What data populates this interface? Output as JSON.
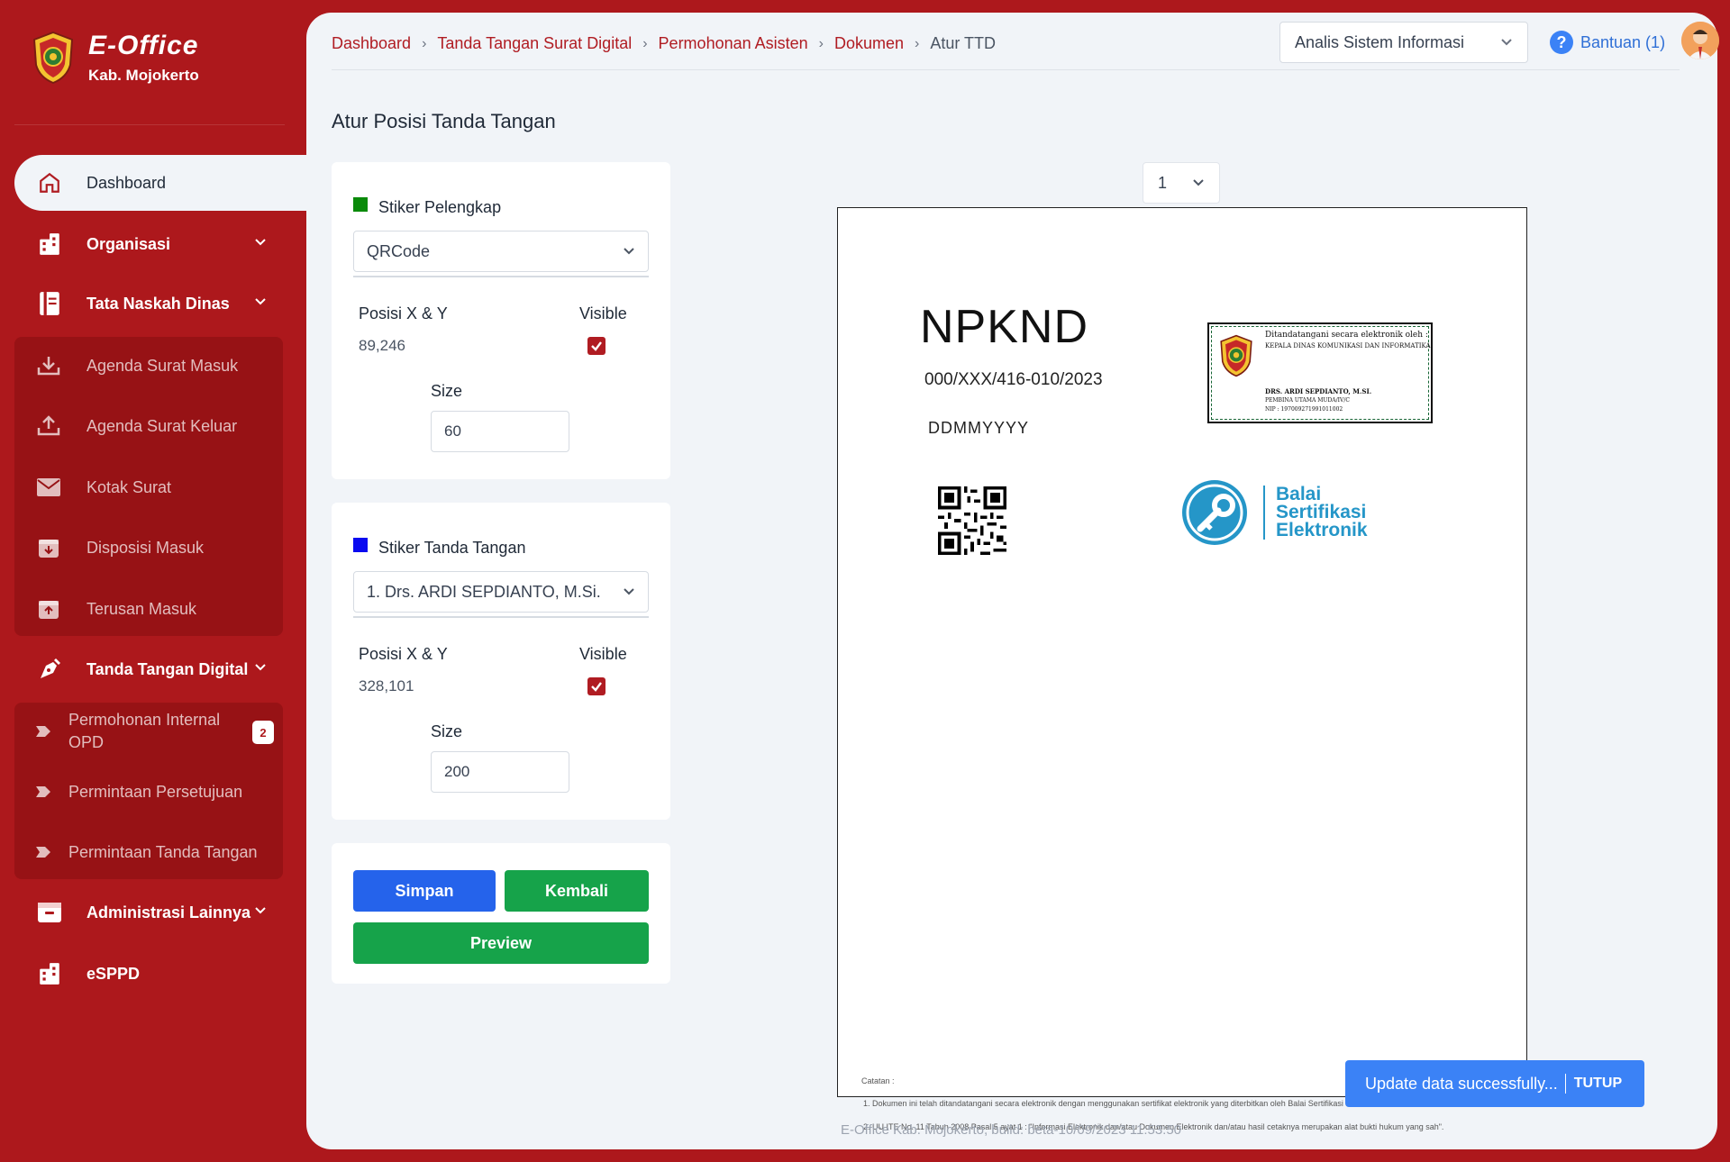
{
  "brand": {
    "title": "E-Office",
    "subtitle": "Kab. Mojokerto"
  },
  "sidebar": {
    "items": [
      {
        "label": "Dashboard"
      },
      {
        "label": "Organisasi"
      },
      {
        "label": "Tata Naskah Dinas"
      },
      {
        "label": "Agenda Surat Masuk"
      },
      {
        "label": "Agenda Surat Keluar"
      },
      {
        "label": "Kotak Surat"
      },
      {
        "label": "Disposisi Masuk"
      },
      {
        "label": "Terusan Masuk"
      },
      {
        "label": "Tanda Tangan Digital"
      },
      {
        "label": "Permohonan Internal OPD",
        "badge": "2"
      },
      {
        "label": "Permintaan Persetujuan"
      },
      {
        "label": "Permintaan Tanda Tangan"
      },
      {
        "label": "Administrasi Lainnya"
      },
      {
        "label": "eSPPD"
      }
    ]
  },
  "header": {
    "breadcrumb": [
      "Dashboard",
      "Tanda Tangan Surat Digital",
      "Permohonan Asisten",
      "Dokumen",
      "Atur TTD"
    ],
    "role": "Analis Sistem Informasi",
    "help": "Bantuan (1)"
  },
  "page_title": "Atur Posisi Tanda Tangan",
  "stiker_pelengkap": {
    "title": "Stiker Pelengkap",
    "color": "#0a8a0a",
    "selected": "QRCode",
    "pos_label": "Posisi X & Y",
    "pos_value": "89,246",
    "visible_label": "Visible",
    "visible": true,
    "size_label": "Size",
    "size_value": "60"
  },
  "stiker_ttd": {
    "title": "Stiker Tanda Tangan",
    "color": "#0a0af0",
    "selected": "1. Drs. ARDI SEPDIANTO, M.Si.",
    "pos_label": "Posisi X & Y",
    "pos_value": "328,101",
    "visible_label": "Visible",
    "visible": true,
    "size_label": "Size",
    "size_value": "200"
  },
  "buttons": {
    "simpan": "Simpan",
    "kembali": "Kembali",
    "preview": "Preview"
  },
  "preview": {
    "page": "1",
    "doc_head": "NPKND",
    "doc_number": "000/XXX/416-010/2023",
    "doc_date": "DDMMYYYY",
    "signature": {
      "title": "Ditandatangani secara elektronik oleh :",
      "org": "KEPALA DINAS KOMUNIKASI DAN INFORMATIKA",
      "name": "DRS. ARDI SEPDIANTO, M.SI.",
      "rank": "PEMBINA UTAMA MUDA/IV/C",
      "nip": "NIP : 197009271991011002"
    },
    "bsre": [
      "Balai",
      "Sertifikasi",
      "Elektronik"
    ],
    "catatan": "Catatan :",
    "note1": "1. Dokumen ini telah ditandatangani secara elektronik dengan menggunakan sertifikat elektronik yang diterbitkan oleh Balai Sertifikasi Elektronik",
    "note2": "2. UU ITE No. 11 Tahun 2008 Pasal 5 ayat 1 : \"Informasi Elektronik dan/atau Dokumen Elektronik dan/atau hasil cetaknya merupakan alat bukti hukum yang sah\"."
  },
  "footer": "E-Office Kab. Mojokerto, build: beta-10/09/2023 11:53:50",
  "toast": {
    "message": "Update data successfully...",
    "close": "TUTUP"
  },
  "colors": {
    "brand": "#ad181c",
    "active_bg": "#f1f4f8",
    "primary": "#2563eb",
    "success": "#16a34a"
  }
}
